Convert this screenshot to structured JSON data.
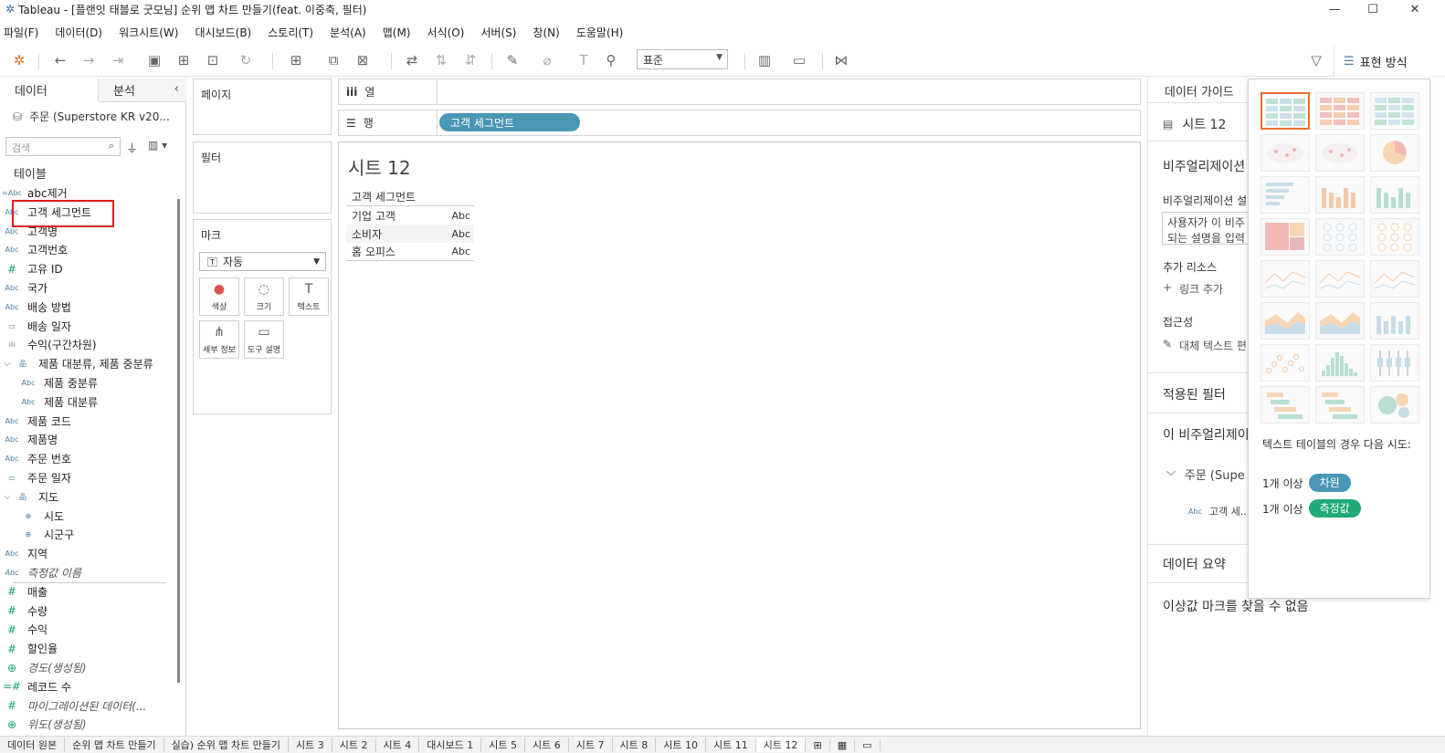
{
  "window": {
    "title": "Tableau - [플랜잇 태블로 굿모닝] 순위 맵 차트 만들기(feat. 이중축, 필터)"
  },
  "menu": [
    "파일(F)",
    "데이터(D)",
    "워크시트(W)",
    "대시보드(B)",
    "스토리(T)",
    "분석(A)",
    "맵(M)",
    "서식(O)",
    "서버(S)",
    "창(N)",
    "도움말(H)"
  ],
  "toolbar": {
    "fit_select": "표준",
    "show_me_label": "표현 방식"
  },
  "left": {
    "tabs": [
      "데이터",
      "분석"
    ],
    "datasource": "주문 (Superstore KR v20...",
    "search_placeholder": "검색",
    "tables_label": "테이블",
    "fields": [
      {
        "icon": "=Abc",
        "label": "abc제거",
        "type": "dim"
      },
      {
        "icon": "Abc",
        "label": "고객 세그먼트",
        "type": "dim"
      },
      {
        "icon": "Abc",
        "label": "고객명",
        "type": "dim"
      },
      {
        "icon": "Abc",
        "label": "고객번호",
        "type": "dim"
      },
      {
        "icon": "#",
        "label": "고유 ID",
        "type": "meas"
      },
      {
        "icon": "Abc",
        "label": "국가",
        "type": "dim"
      },
      {
        "icon": "Abc",
        "label": "배송 방법",
        "type": "dim"
      },
      {
        "icon": "▭",
        "label": "배송 일자",
        "type": "dim"
      },
      {
        "icon": "ılı",
        "label": "수익(구간차원)",
        "type": "dim"
      },
      {
        "icon": "品",
        "label": "제품 대분류, 제품 중분류",
        "type": "dim",
        "indent": 1
      },
      {
        "icon": "Abc",
        "label": "제품 중분류",
        "type": "dim",
        "indent": 2
      },
      {
        "icon": "Abc",
        "label": "제품 대분류",
        "type": "dim",
        "indent": 2
      },
      {
        "icon": "Abc",
        "label": "제품 코드",
        "type": "dim"
      },
      {
        "icon": "Abc",
        "label": "제품명",
        "type": "dim"
      },
      {
        "icon": "Abc",
        "label": "주문 번호",
        "type": "dim"
      },
      {
        "icon": "▭",
        "label": "주문 일자",
        "type": "dim"
      },
      {
        "icon": "品",
        "label": "지도",
        "type": "dim",
        "indent": 1
      },
      {
        "icon": "⊕",
        "label": "시도",
        "type": "dim",
        "indent": 2
      },
      {
        "icon": "⊕",
        "label": "시군구",
        "type": "dim",
        "indent": 2
      },
      {
        "icon": "Abc",
        "label": "지역",
        "type": "dim"
      },
      {
        "icon": "Abc",
        "label": "측정값 이름",
        "type": "dim",
        "italic": true
      },
      {
        "icon": "#",
        "label": "매출",
        "type": "meas"
      },
      {
        "icon": "#",
        "label": "수량",
        "type": "meas"
      },
      {
        "icon": "#",
        "label": "수익",
        "type": "meas"
      },
      {
        "icon": "#",
        "label": "할인율",
        "type": "meas"
      },
      {
        "icon": "⊕",
        "label": "경도(생성됨)",
        "type": "meas",
        "italic": true
      },
      {
        "icon": "=#",
        "label": "레코드 수",
        "type": "meas"
      },
      {
        "icon": "#",
        "label": "마이그레이션된 데이터(...",
        "type": "meas",
        "italic": true
      },
      {
        "icon": "⊕",
        "label": "위도(생성됨)",
        "type": "meas",
        "italic": true
      }
    ]
  },
  "cards": {
    "pages": "페이지",
    "filters": "필터",
    "marks": "마크",
    "marks_type": "자동",
    "mark_buttons": [
      {
        "icon": "●",
        "label": "색상"
      },
      {
        "icon": "◌",
        "label": "크기"
      },
      {
        "icon": "T",
        "label": "텍스트"
      },
      {
        "icon": "⋔",
        "label": "세부 정보"
      },
      {
        "icon": "▭",
        "label": "도구 설명"
      }
    ]
  },
  "shelves": {
    "columns_label": "열",
    "rows_label": "행",
    "rows_pill": "고객 세그먼트"
  },
  "sheet": {
    "title": "시트 12",
    "header": "고객 세그먼트",
    "rows": [
      {
        "label": "기업 고객",
        "value": "Abc"
      },
      {
        "label": "소비자",
        "value": "Abc"
      },
      {
        "label": "홈 오피스",
        "value": "Abc"
      }
    ]
  },
  "guide": {
    "title": "데이터 가이드",
    "sheet_name": "시트 12",
    "viz_desc_title": "비주얼리제이션",
    "viz_desc_sub": "비주얼리제이션 설",
    "desc_placeholder_1": "사용자가 이 비주",
    "desc_placeholder_2": "되는 설명을 입력",
    "extra_resources": "추가 리소스",
    "add_link": "링크 추가",
    "accessibility": "접근성",
    "alt_text": "대체 텍스트 편",
    "applied_filters": "적용된 필터",
    "this_viz": "이 비주얼리제이",
    "source": "주문 (Supe",
    "source_field": "고객 세...",
    "data_summary": "데이터 요약",
    "outlier": "이상값 마크를 찾을 수 없음"
  },
  "showme": {
    "hint": "텍스트 테이블의 경우 다음 시도:",
    "req1_count": "1개 이상",
    "req1_pill": "차원",
    "req2_count": "1개 이상",
    "req2_pill": "측정값"
  },
  "colors": {
    "dim_pill": "#4a96b5",
    "meas_pill": "#1faa78",
    "accent": "#e8702a",
    "highlight": "#e21a1a"
  },
  "statusbar": {
    "tabs": [
      "데이터 원본",
      "순위 맵 차트 만들기",
      "실습) 순위 맵 차트 만들기",
      "시트 3",
      "시트 2",
      "시트 4",
      "대시보드 1",
      "시트 5",
      "시트 6",
      "시트 7",
      "시트 8",
      "시트 10",
      "시트 11",
      "시트 12"
    ]
  }
}
